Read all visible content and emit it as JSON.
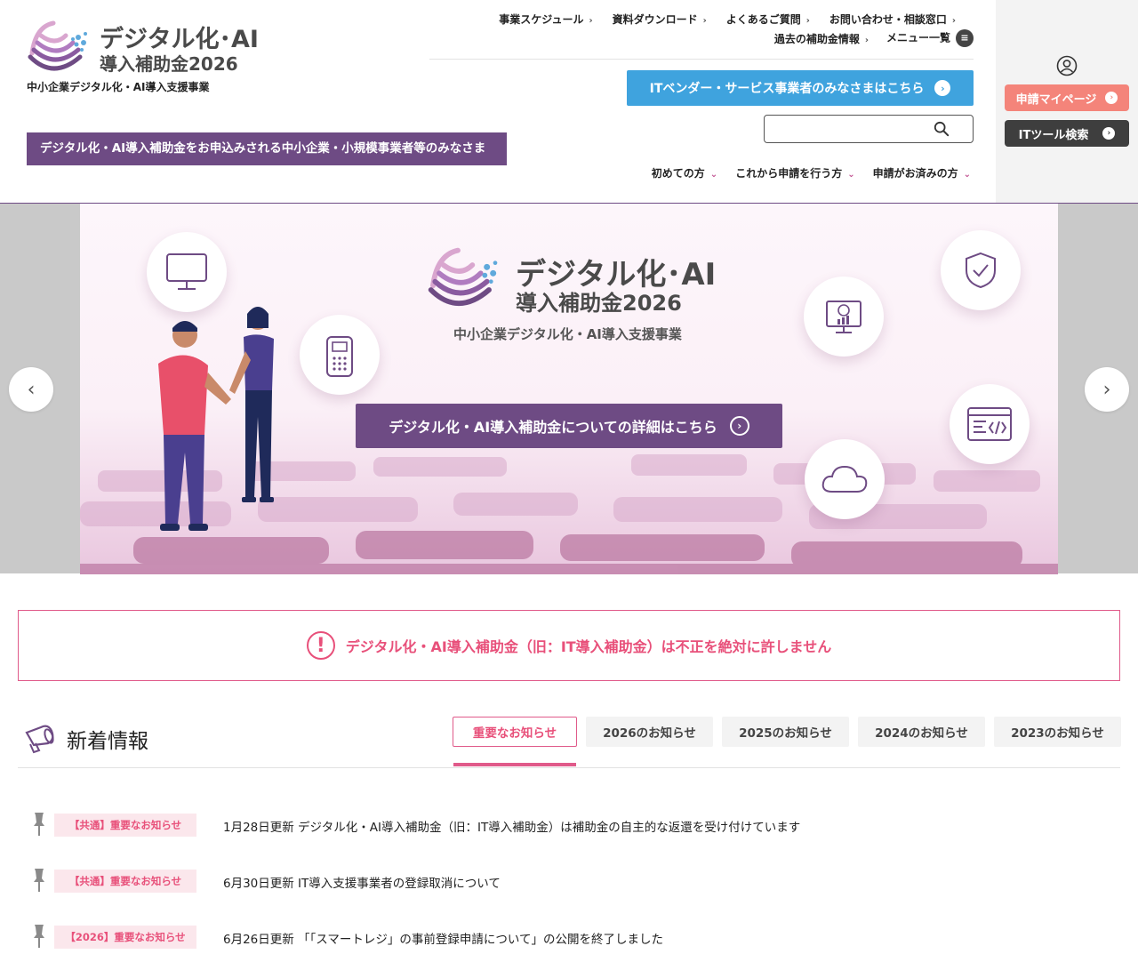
{
  "header": {
    "logo_line1": "デジタル化･AI",
    "logo_line2": "導入補助金2026",
    "logo_sub": "中小企業デジタル化・AI導入支援事業",
    "lead_bar": "デジタル化・AI導入補助金をお申込みされる中小企業・小規模事業者等のみなさま",
    "util_nav": [
      "事業スケジュール",
      "資料ダウンロード",
      "よくあるご質問",
      "お問い合わせ・相談窓口"
    ],
    "util_nav2": [
      "過去の補助金情報",
      "メニュー一覧"
    ],
    "vendor_button": "ITベンダー・サービス事業者のみなさまはこちら",
    "search_placeholder": "",
    "main_nav": [
      "初めての方",
      "これから申請を行う方",
      "申請がお済みの方"
    ],
    "mypage_button": "申請マイページ",
    "tool_button": "ITツール検索"
  },
  "hero": {
    "logo_line1": "デジタル化･AI",
    "logo_line2": "導入補助金2026",
    "sub": "中小企業デジタル化・AI導入支援事業",
    "button": "デジタル化・AI導入補助金についての詳細はこちら"
  },
  "alert": {
    "text": "デジタル化・AI導入補助金（旧：IT導入補助金）は不正を絶対に許しません"
  },
  "news": {
    "title": "新着情報",
    "tabs": [
      "重要なお知らせ",
      "2026のお知らせ",
      "2025のお知らせ",
      "2024のお知らせ",
      "2023のお知らせ"
    ],
    "items": [
      {
        "badge": "【共通】重要なお知らせ",
        "text": "1月28日更新 デジタル化・AI導入補助金（旧：IT導入補助金）は補助金の自主的な返還を受け付けています"
      },
      {
        "badge": "【共通】重要なお知らせ",
        "text": "6月30日更新 IT導入支援事業者の登録取消について"
      },
      {
        "badge": "【2026】重要なお知らせ",
        "text": "6月26日更新 「「スマートレジ」の事前登録申請について」の公開を終了しました"
      }
    ]
  },
  "colors": {
    "brand_purple": "#6e4b84",
    "accent_pink": "#e8507a",
    "vendor_blue": "#3fa3de",
    "mypage_coral": "#f4847a"
  }
}
